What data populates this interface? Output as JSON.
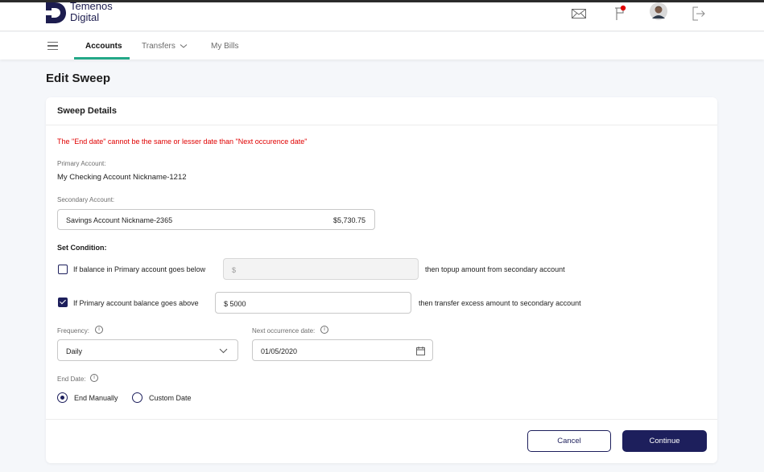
{
  "brand": {
    "line1": "Temenos",
    "line2": "Digital"
  },
  "nav": {
    "tabs": [
      "Accounts",
      "Transfers",
      "My Bills"
    ]
  },
  "page_title": "Edit Sweep",
  "card": {
    "title": "Sweep Details",
    "error": "The \"End date\" cannot be the same or lesser date than \"Next occurence date\"",
    "primary_label": "Primary Account:",
    "primary_value": "My Checking Account Nickname-1212",
    "secondary_label": "Secondary Account:",
    "secondary_name": "Savings Account Nickname-2365",
    "secondary_amount": "$5,730.75",
    "set_condition": "Set Condition:",
    "cond1": {
      "label": "If balance in Primary account goes below",
      "value": "$",
      "suffix": "then topup amount from secondary account",
      "checked": false
    },
    "cond2": {
      "label": "If Primary account balance goes above",
      "value": "$ 5000",
      "suffix": "then transfer excess amount to secondary account",
      "checked": true
    },
    "frequency_label": "Frequency:",
    "frequency_value": "Daily",
    "next_label": "Next occurrence date:",
    "next_value": "01/05/2020",
    "end_label": "End Date:",
    "end_options": [
      "End Manually",
      "Custom Date"
    ],
    "end_selected": "End Manually",
    "cancel": "Cancel",
    "continue": "Continue"
  },
  "colors": {
    "primary": "#1d1f5c",
    "accent": "#23a887",
    "error": "#e00000",
    "notification": "#e00000"
  },
  "icons": [
    "logo-icon",
    "mail-icon",
    "flag-icon",
    "avatar",
    "logout-icon",
    "menu-icon",
    "chevron-down-icon",
    "info-icon",
    "calendar-icon",
    "check-icon"
  ]
}
